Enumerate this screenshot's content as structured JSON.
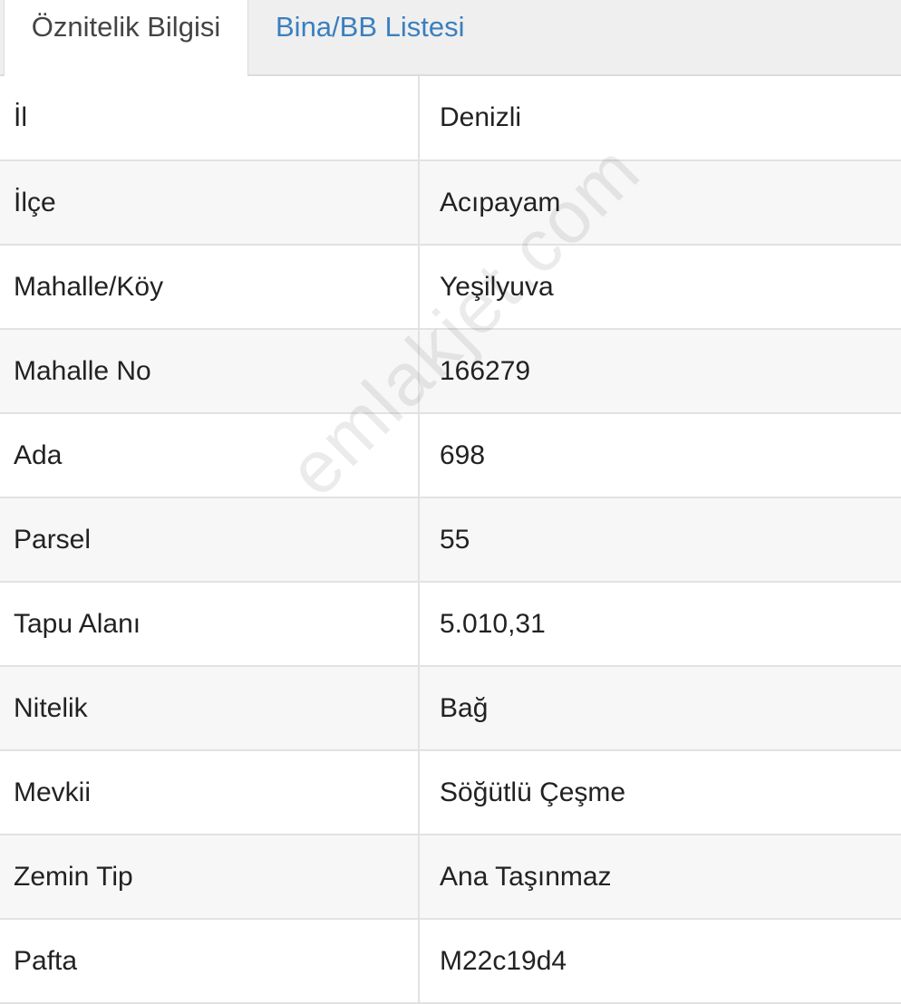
{
  "tabs": [
    {
      "label": "Öznitelik Bilgisi",
      "active": true
    },
    {
      "label": "Bina/BB Listesi",
      "active": false
    }
  ],
  "rows": [
    {
      "label": "İl",
      "value": "Denizli"
    },
    {
      "label": "İlçe",
      "value": "Acıpayam"
    },
    {
      "label": "Mahalle/Köy",
      "value": "Yeşilyuva"
    },
    {
      "label": "Mahalle No",
      "value": "166279"
    },
    {
      "label": "Ada",
      "value": "698"
    },
    {
      "label": "Parsel",
      "value": "55"
    },
    {
      "label": "Tapu Alanı",
      "value": "5.010,31"
    },
    {
      "label": "Nitelik",
      "value": "Bağ"
    },
    {
      "label": "Mevkii",
      "value": "Söğütlü Çeşme"
    },
    {
      "label": "Zemin Tip",
      "value": "Ana Taşınmaz"
    },
    {
      "label": "Pafta",
      "value": "M22c19d4"
    }
  ],
  "watermark": "emlakjet.com",
  "colors": {
    "tab_link": "#3a7fc0",
    "row_alt_bg": "#f7f7f7",
    "border": "#e2e2e2"
  }
}
